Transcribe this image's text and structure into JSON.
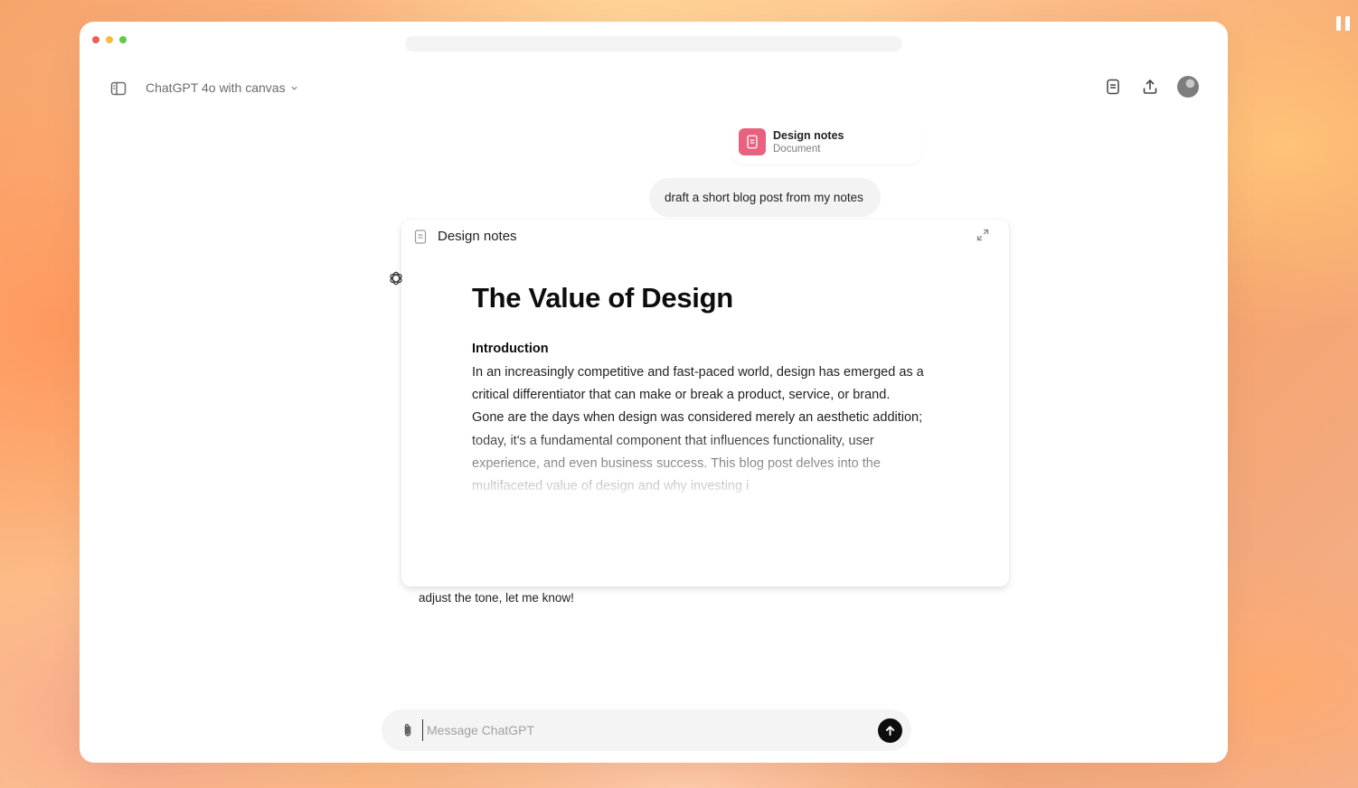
{
  "model_selector": {
    "label": "ChatGPT 4o with canvas"
  },
  "attachment": {
    "title": "Design notes",
    "subtitle": "Document"
  },
  "user_message": "draft a short blog post from my notes",
  "canvas": {
    "header_label": "Design notes",
    "title": "The Value of Design",
    "section_heading": "Introduction",
    "paragraph": "In an increasingly competitive and fast-paced world, design has emerged as a critical differentiator that can make or break a product, service, or brand. Gone are the days when design was considered merely an aesthetic addition; today, it's a fundamental component that influences functionality, user experience, and even business success. This blog post delves into the multifaceted value of design and why investing i"
  },
  "assistant_partial": "adjust the tone, let me know!",
  "composer": {
    "placeholder": "Message ChatGPT",
    "value": ""
  },
  "icons": {
    "sidebar_toggle": "sidebar-icon",
    "model_chevron": "chevron-down-icon",
    "canvas_toggle": "document-icon",
    "share": "upload-icon",
    "assistant": "openai-logo-icon",
    "expand": "expand-icon",
    "attach": "paperclip-icon",
    "send": "arrow-up-icon"
  },
  "colors": {
    "doc_badge": "#e9617f",
    "send_button": "#0d0d0d",
    "user_bubble": "#f3f3f3"
  }
}
